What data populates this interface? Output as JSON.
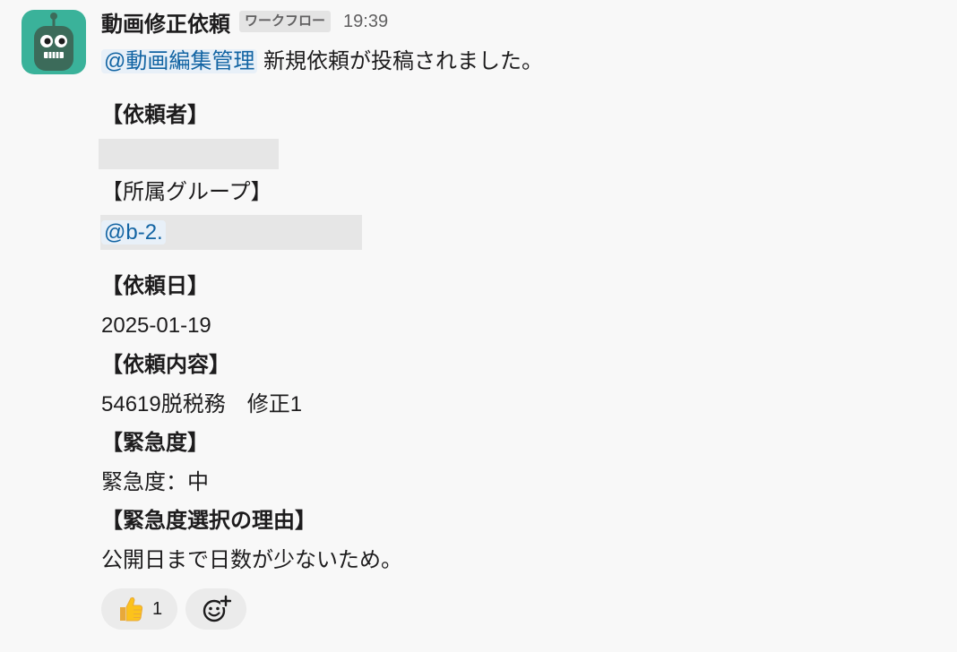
{
  "message": {
    "sender": "動画修正依頼",
    "badge": "ワークフロー",
    "time": "19:39",
    "mention": "@動画編集管理",
    "intro": " 新規依頼が投稿されました。",
    "fields": {
      "requester_label": "【依頼者】",
      "group_label": "【所属グループ】",
      "group_value": "@b-2.",
      "date_label": "【依頼日】",
      "date_value": "2025-01-19",
      "content_label": "【依頼内容】",
      "content_value": "54619脱税務　修正1",
      "urgency_label": "【緊急度】",
      "urgency_value": "緊急度：中",
      "reason_label": "【緊急度選択の理由】",
      "reason_value": "公開日まで日数が少ないため。"
    },
    "reactions": [
      {
        "icon": "thumbs-up-icon",
        "count": "1"
      },
      {
        "icon": "add-reaction-icon"
      }
    ]
  },
  "colors": {
    "avatar_bg": "#3ab29a",
    "robot_body": "#3c6b5a",
    "mention_text": "#1264a3",
    "background": "#f8f8f8"
  }
}
